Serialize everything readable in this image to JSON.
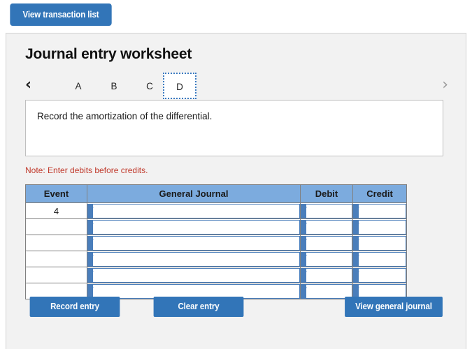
{
  "top": {
    "view_transaction_list_label": "View transaction list"
  },
  "panel": {
    "title": "Journal entry worksheet",
    "nav": {
      "prev_icon": "chevron-left-icon",
      "next_icon": "chevron-right-icon",
      "prev_glyph": "‹",
      "next_glyph": "›"
    },
    "tabs": [
      {
        "label": "A",
        "active": false
      },
      {
        "label": "B",
        "active": false
      },
      {
        "label": "C",
        "active": false
      },
      {
        "label": "D",
        "active": true
      }
    ],
    "instruction": "Record the amortization of the differential.",
    "note": "Note: Enter debits before credits."
  },
  "table": {
    "headers": [
      "Event",
      "General Journal",
      "Debit",
      "Credit"
    ],
    "rows": [
      {
        "event": "4",
        "journal": "",
        "debit": "",
        "credit": ""
      },
      {
        "event": "",
        "journal": "",
        "debit": "",
        "credit": ""
      },
      {
        "event": "",
        "journal": "",
        "debit": "",
        "credit": ""
      },
      {
        "event": "",
        "journal": "",
        "debit": "",
        "credit": ""
      },
      {
        "event": "",
        "journal": "",
        "debit": "",
        "credit": ""
      },
      {
        "event": "",
        "journal": "",
        "debit": "",
        "credit": ""
      }
    ]
  },
  "actions": {
    "record_entry_label": "Record entry",
    "clear_entry_label": "Clear entry",
    "view_general_journal_label": "View general journal"
  },
  "colors": {
    "button_blue": "#3275b8",
    "header_blue": "#7cabde",
    "field_border_blue": "#4a7ebb",
    "note_red": "#c0392b",
    "panel_bg": "#f2f2f2"
  }
}
